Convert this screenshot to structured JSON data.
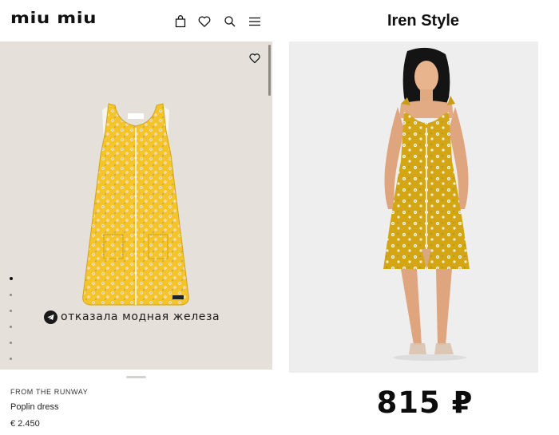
{
  "left_store": {
    "logo": "miu miu",
    "nav_icons": [
      "bag-icon",
      "heart-icon",
      "search-icon",
      "menu-icon"
    ],
    "carousel": {
      "total_slides": 6,
      "active_slide": 1
    },
    "watermark": "отказала модная железа",
    "category": "FROM THE RUNWAY",
    "product_name": "Poplin dress",
    "price": "€ 2.450"
  },
  "right_store": {
    "brand": "Iren Style",
    "price": "815 ₽"
  },
  "colors": {
    "stage_bg": "#e5e1da",
    "dress_yellow": "#f4c52a",
    "dress_mustard": "#d2a417",
    "photo_bg": "#eeeeee"
  }
}
